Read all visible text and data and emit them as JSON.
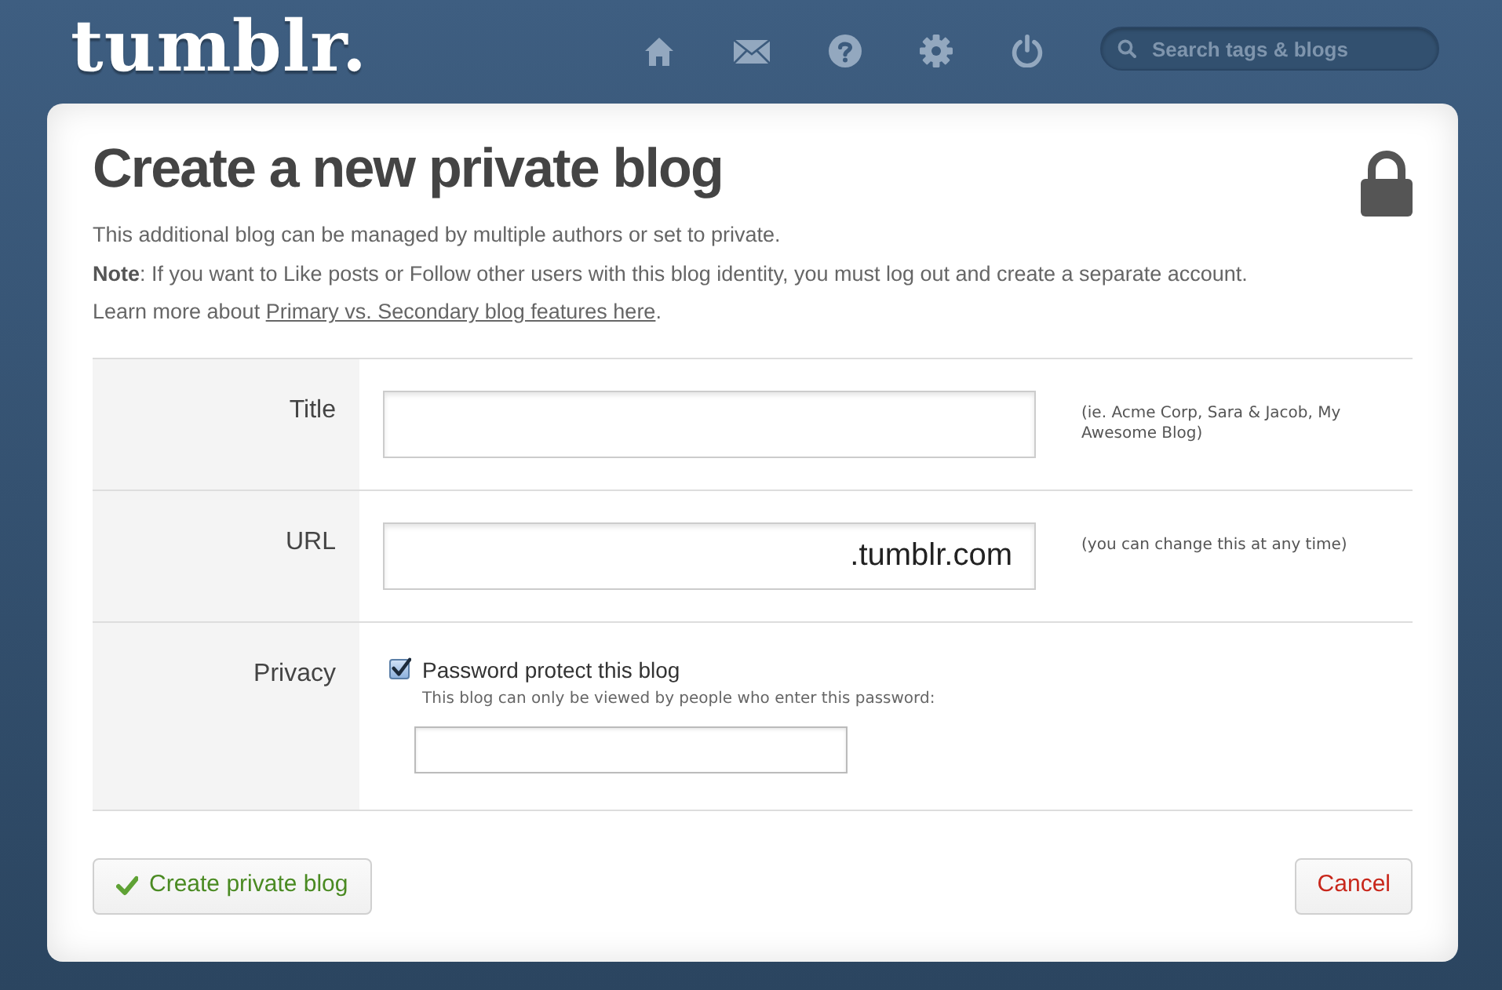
{
  "header": {
    "logo": "tumblr.",
    "search": {
      "placeholder": "Search tags & blogs"
    }
  },
  "page": {
    "title": "Create a new private blog",
    "paragraphs": [
      {
        "kind": "plain",
        "text": "This additional blog can be managed by multiple authors or set to private."
      },
      {
        "kind": "plain",
        "text": "**Note**: If you want to Like posts or Follow other users with this blog identity, you must log out and create a separate account."
      },
      {
        "kind": "link",
        "before": "Learn more about ",
        "link": "Primary vs. Secondary blog features here",
        "after": "."
      }
    ]
  },
  "form": {
    "rows": [
      {
        "kind": "text",
        "label": "Title",
        "hint": "(ie. Acme Corp, Sara & Jacob, My Awesome Blog)"
      },
      {
        "kind": "url",
        "label": "URL",
        "suffix": ".tumblr.com",
        "hint": "(you can change this at any time)"
      },
      {
        "kind": "privacy",
        "label": "Privacy",
        "checkbox": {
          "label": "Password protect this blog",
          "checked": true
        },
        "description": "This blog can only be viewed by people who enter this password:"
      }
    ]
  },
  "buttons": [
    {
      "kind": "submit",
      "label": "Create private blog"
    },
    {
      "kind": "cancel",
      "label": "Cancel"
    }
  ]
}
